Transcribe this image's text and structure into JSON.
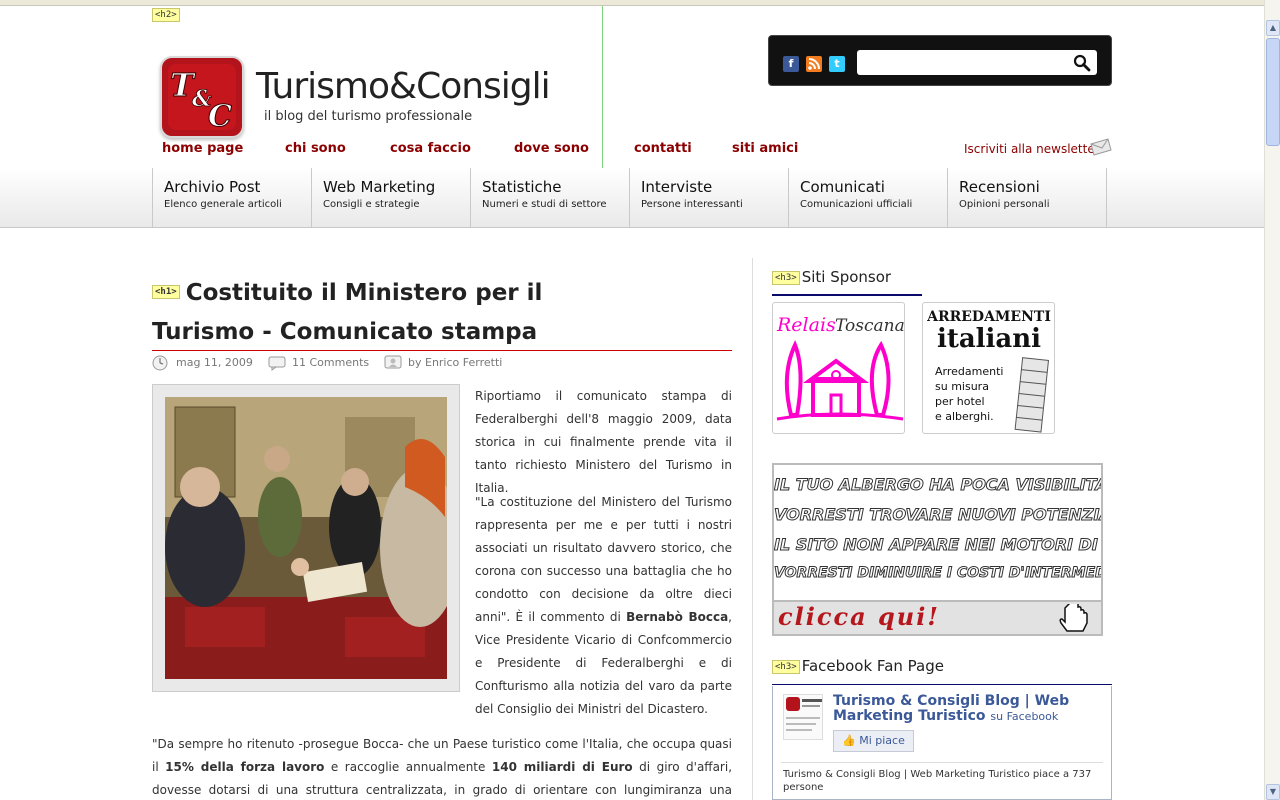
{
  "header": {
    "h2_tag": "<h2>",
    "logo_text": "T&C",
    "site_title": "Turismo&Consigli",
    "site_subtitle": "il blog del turismo professionale",
    "nav": [
      "home page",
      "chi sono",
      "cosa faccio",
      "dove sono",
      "contatti",
      "siti amici"
    ],
    "newsletter": "Iscriviti alla newsletter",
    "search_placeholder": ""
  },
  "categories": [
    {
      "title": "Archivio Post",
      "sub": "Elenco generale articoli"
    },
    {
      "title": "Web Marketing",
      "sub": "Consigli e strategie"
    },
    {
      "title": "Statistiche",
      "sub": "Numeri e studi di settore"
    },
    {
      "title": "Interviste",
      "sub": "Persone interessanti"
    },
    {
      "title": "Comunicati",
      "sub": "Comunicazioni ufficiali"
    },
    {
      "title": "Recensioni",
      "sub": "Opinioni personali"
    }
  ],
  "article": {
    "h1_tag": "<h1>",
    "title": "Costituito il Ministero per il Turismo - Comunicato stampa",
    "date": "mag 11, 2009",
    "comments": "11 Comments",
    "author": "by Enrico Ferretti",
    "p1": "Riportiamo il comunicato stampa di Federalberghi dell'8 maggio 2009, data storica in cui finalmente prende vita il tanto richiesto Ministero del Turismo in Italia.",
    "p2_a": "\"La costituzione del Ministero del Turismo rappresenta per me e per tutti i nostri associati un risultato davvero storico, che corona con successo una battaglia che ho condotto con decisione da oltre dieci anni\". È il commento di ",
    "p2_b": "Bernabò Bocca",
    "p2_c": ", Vice Presidente Vicario di Confcommercio e Presidente di Federalberghi e di Confturismo alla notizia del varo da parte del Consiglio dei Ministri del Dicastero.",
    "p3_a": "\"Da sempre ho ritenuto -prosegue Bocca- che un Paese turistico come l'Italia, che occupa quasi il ",
    "p3_b": "15% della forza lavoro",
    "p3_c": " e raccoglie annualmente ",
    "p3_d": "140 miliardi di Euro",
    "p3_e": " di giro d'affari, dovesse dotarsi di una struttura centralizzata, in grado di orientare con lungimiranza una politica del settore."
  },
  "sidebar": {
    "h3_tag": "<h3>",
    "sponsor_title": "Siti Sponsor",
    "sponsor1": {
      "line1": "Relais",
      "line2": "Toscana"
    },
    "sponsor2": {
      "line1": "ARREDAMENTI",
      "line2": "italiani",
      "line3": "Arredamenti",
      "line4": "su misura",
      "line5": "per hotel",
      "line6": "e alberghi."
    },
    "banner": {
      "lines": [
        "IL TUO ALBERGO HA POCA VISIBILITA' SUL WEB?",
        "VORRESTI TROVARE NUOVI POTENZIALI CLIENTI?",
        "IL SITO NON APPARE NEI MOTORI DI RICERCA?",
        "VORRESTI DIMINUIRE I COSTI D'INTERMEDIAZIONE?"
      ],
      "cta": "clicca qui!"
    },
    "fb_title": "Facebook Fan Page",
    "fb_name": "Turismo & Consigli Blog | Web Marketing Turistico",
    "fb_on": "su Facebook",
    "fb_like": "Mi piace",
    "fb_count": "Turismo & Consigli Blog | Web Marketing Turistico piace a 737 persone"
  },
  "colors": {
    "accent": "#8b0000",
    "rule": "#cc0000",
    "fb": "#3b5998"
  }
}
